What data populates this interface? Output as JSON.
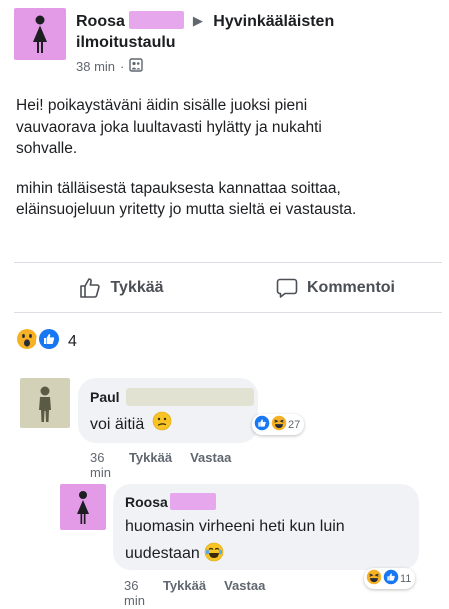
{
  "post": {
    "author": "Roosa",
    "group_line1": "Hyvinkääläisten",
    "group_line2": "ilmoitustaulu",
    "time": "38 min",
    "separator": "·",
    "paragraph1": "Hei! poikaystäväni äidin sisälle juoksi pieni vauvaorava joka luultavasti hylätty ja nukahti sohvalle.",
    "paragraph2": "mihin tälläisestä tapauksesta kannattaa soittaa, eläinsuojeluun yritetty jo mutta sieltä ei vastausta."
  },
  "actions": {
    "like_label": "Tykkää",
    "comment_label": "Kommentoi"
  },
  "reactions": {
    "count": "4",
    "icons": [
      "wow-emoji-icon",
      "like-reaction-icon"
    ]
  },
  "comments": [
    {
      "author": "Paul",
      "text": "voi äitiä",
      "time": "36 min",
      "like_label": "Tykkää",
      "reply_label": "Vastaa",
      "reaction_count": "27"
    },
    {
      "author": "Roosa",
      "text": "huomasin virheeni heti kun luin uudestaan",
      "time": "36 min",
      "like_label": "Tykkää",
      "reply_label": "Vastaa",
      "reaction_count": "11"
    }
  ],
  "colors": {
    "redaction_pink": "#e7a7ec",
    "avatar_pink": "#e39be8",
    "avatar_olive": "#d3d1b7",
    "like_blue": "#1877f2",
    "bubble_gray": "#f0f2f5"
  }
}
